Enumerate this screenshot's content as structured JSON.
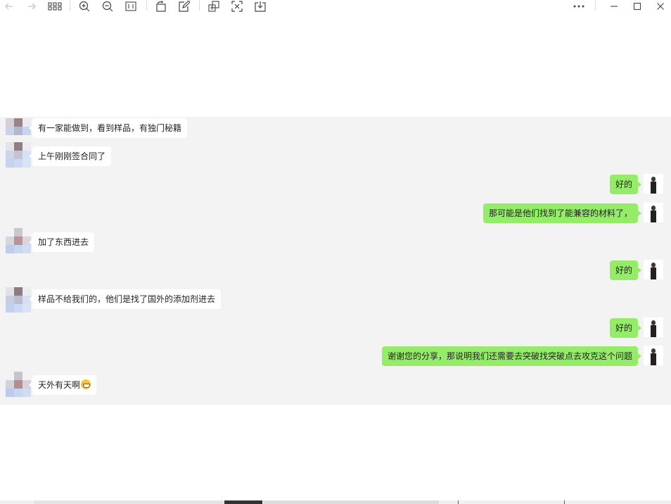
{
  "toolbar": {
    "left_icons": [
      "back-arrow-icon",
      "forward-arrow-icon",
      "grid-icon",
      "zoom-in-icon",
      "zoom-out-icon",
      "actual-size-icon",
      "rotate-icon",
      "edit-icon",
      "copy-icon",
      "crop-icon",
      "download-icon"
    ],
    "right_icons": [
      "more-icon",
      "minimize-icon",
      "maximize-icon",
      "close-icon"
    ]
  },
  "messages": [
    {
      "side": "left",
      "text": "有一家能做到，看到样品，有独门秘籍"
    },
    {
      "side": "left",
      "text": "上午刚刚签合同了"
    },
    {
      "side": "right",
      "text": "好的"
    },
    {
      "side": "right",
      "text": "那可能是他们找到了能兼容的材料了，"
    },
    {
      "side": "left",
      "text": "加了东西进去"
    },
    {
      "side": "right",
      "text": "好的"
    },
    {
      "side": "left",
      "text": "样品不给我们的，他们是找了国外的添加剂进去"
    },
    {
      "side": "right",
      "text": "好的"
    },
    {
      "side": "right",
      "text": "谢谢您的分享，那说明我们还需要去突破找突破点去攻克这个问题"
    },
    {
      "side": "left",
      "text": "天外有天啊",
      "emoji": "grin-emoji"
    }
  ],
  "colors": {
    "chat_background": "#f3f3f3",
    "incoming_bubble": "#ffffff",
    "outgoing_bubble": "#95ec69"
  }
}
